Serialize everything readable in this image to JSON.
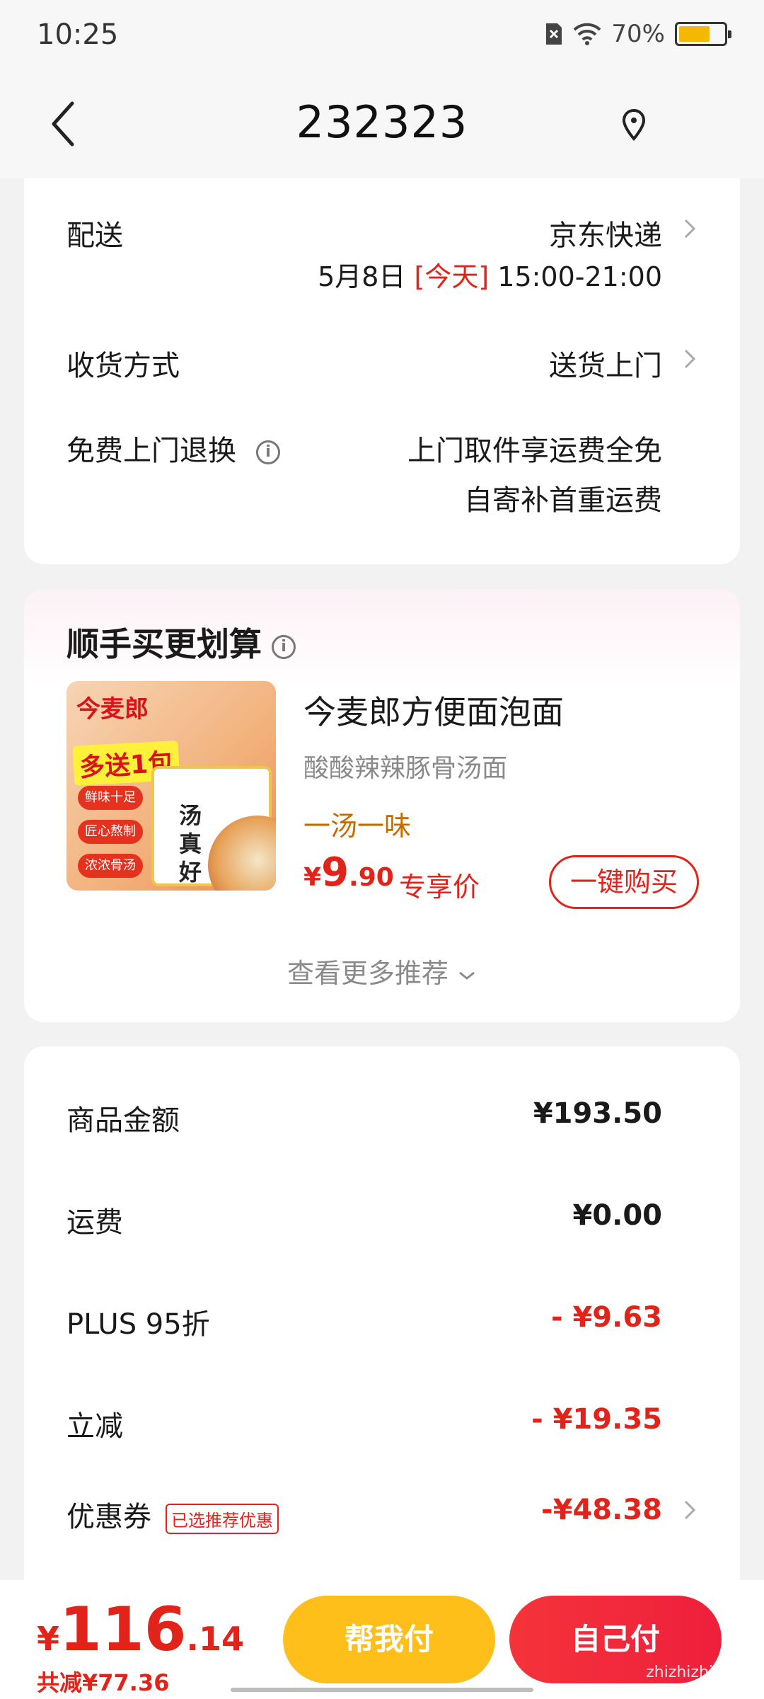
{
  "status": {
    "time": "10:25",
    "battery": "70%",
    "battery_level": 0.7
  },
  "nav": {
    "title": "232323"
  },
  "delivery": {
    "label": "配送",
    "carrier": "京东快递",
    "date": "5月8日",
    "today": "[今天]",
    "time_window": "15:00-21:00",
    "receive_label": "收货方式",
    "receive_value": "送货上门",
    "return_label": "免费上门退换",
    "return_line1": "上门取件享运费全免",
    "return_line2": "自寄补首重运费"
  },
  "reco": {
    "title": "顺手买更划算",
    "product": {
      "name": "今麦郎方便面泡面",
      "subtitle": "酸酸辣辣豚骨汤面",
      "tag": "一汤一味",
      "price_currency": "¥",
      "price_int": "9",
      "price_dec": ".90",
      "price_label": "专享价",
      "buy_label": "一键购买",
      "image_text": {
        "brand": "今麦郎",
        "badge": "多送1包",
        "tags": [
          "鲜味十足",
          "匠心熬制",
          "浓浓骨汤"
        ],
        "box_text": "汤真好"
      }
    },
    "more_label": "查看更多推荐"
  },
  "summary": {
    "rows": [
      {
        "label": "商品金额",
        "value": "¥193.50",
        "style": "normal"
      },
      {
        "label": "运费",
        "value": "¥0.00",
        "style": "normal"
      },
      {
        "label": "PLUS 95折",
        "value": "- ¥9.63",
        "style": "red"
      },
      {
        "label": "立减",
        "value": "- ¥19.35",
        "style": "red"
      },
      {
        "label": "优惠券",
        "value": "-¥48.38",
        "style": "red"
      }
    ],
    "coupon_tag": "已选推荐优惠"
  },
  "bottom": {
    "total_currency": "¥",
    "total_int": "116",
    "total_dec": ".14",
    "saved": "共减¥77.36",
    "help_pay": "帮我付",
    "self_pay": "自己付",
    "watermark": "zhizhizhi.com"
  },
  "colors": {
    "accent_red": "#e2231a",
    "accent_yellow": "#ffbf1a",
    "tag_orange": "#c76b00"
  }
}
